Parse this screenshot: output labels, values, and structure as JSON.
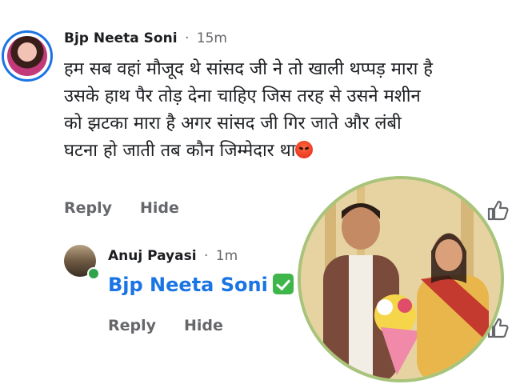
{
  "comment": {
    "author": "Bjp Neeta Soni",
    "separator": "·",
    "time": "15m",
    "text": "हम सब वहां मौजूद थे सांसद जी ने तो खाली थप्पड़ मारा है\nउसके हाथ पैर तोड़ देना चाहिए जिस तरह से उसने मशीन\nको झटका मारा है अगर सांसद जी गिर जाते और लंबी\nघटना हो जाती तब कौन जिम्मेदार था",
    "emoji": "angry-face-icon",
    "actions": {
      "reply": "Reply",
      "hide": "Hide"
    }
  },
  "reply": {
    "author": "Anuj Payasi",
    "separator": "·",
    "time": "1m",
    "mention": "Bjp Neeta Soni",
    "emoji": "check-mark-icon",
    "actions": {
      "reply": "Reply",
      "hide": "Hide"
    }
  },
  "colors": {
    "accent": "#1b74e4",
    "muted": "#65676b",
    "online": "#31a24c",
    "photo_border": "#a8c47a"
  },
  "icons": [
    "like-icon",
    "online-status-icon"
  ]
}
